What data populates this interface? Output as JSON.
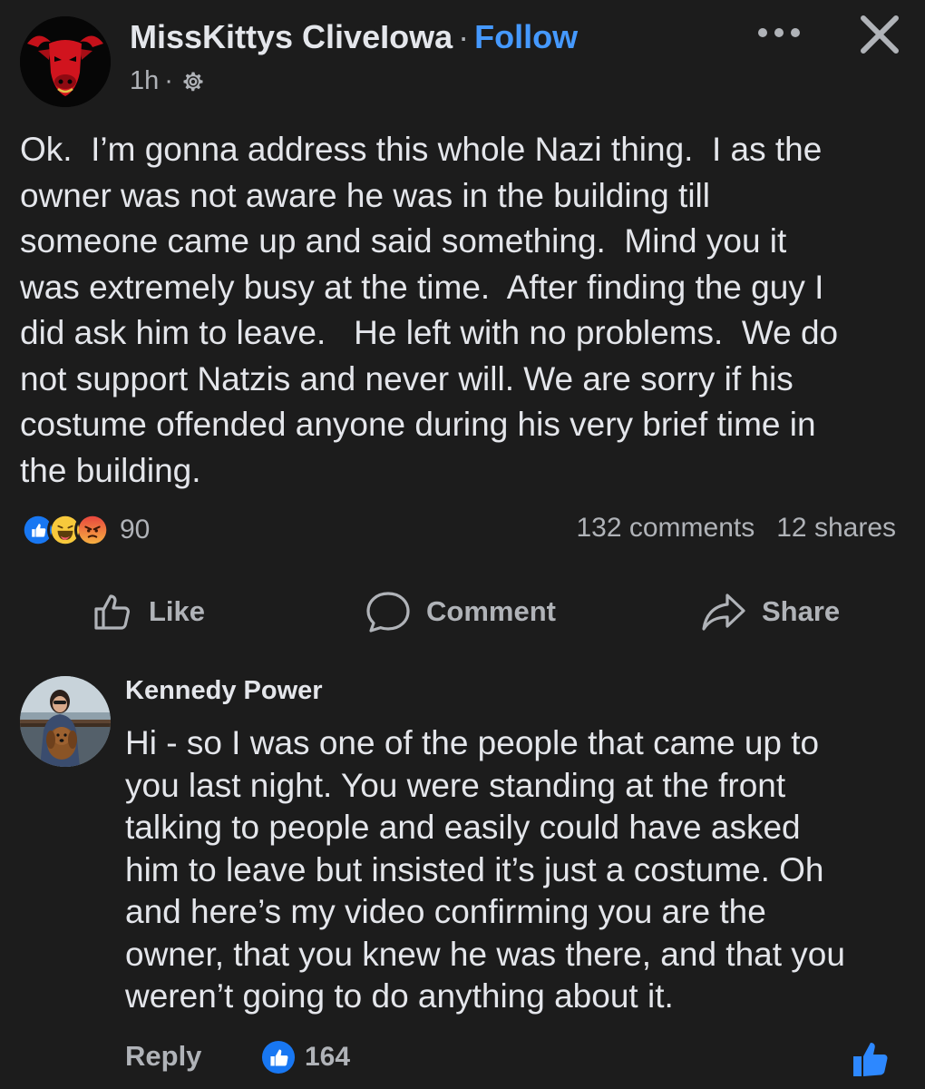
{
  "post": {
    "author": "MissKittys CliveIowa",
    "separator": "·",
    "follow_label": "Follow",
    "time": "1h",
    "meta_separator": "·",
    "privacy_icon": "gear-icon",
    "more_icon": "more-options-icon",
    "close_icon": "close-icon",
    "text": "Ok.  I’m gonna address this whole Nazi thing.  I as the\nowner was not aware he was in the building till\nsomeone came up and said something.  Mind you it\nwas extremely busy at the time.  After finding the guy I\ndid ask him to leave.   He left with no problems.  We do\nnot support Natzis and never will. We are sorry if his\ncostume offended anyone during his very brief time in\nthe building.",
    "reactions": [
      "like",
      "haha",
      "angry"
    ],
    "reaction_count": "90",
    "comments_count": "132 comments",
    "shares_count": "12 shares"
  },
  "actions": {
    "like": "Like",
    "comment": "Comment",
    "share": "Share"
  },
  "comment": {
    "author": "Kennedy Power",
    "text": "Hi - so I was one of the people that came up to\nyou last night. You were standing at the front\ntalking to people and easily could have asked\nhim to leave but insisted it’s just a costume. Oh\nand here’s my video confirming you are the\nowner, that you knew he was there, and that you\nweren’t going to do anything about it.",
    "reply_label": "Reply",
    "like_count": "164"
  },
  "colors": {
    "background": "#1c1c1c",
    "text_primary": "#e4e6eb",
    "text_secondary": "#b0b3b8",
    "link_blue": "#4599ff",
    "like_blue": "#1877f2",
    "angry_red": "#e9463e",
    "haha_yellow": "#f7c93c"
  }
}
